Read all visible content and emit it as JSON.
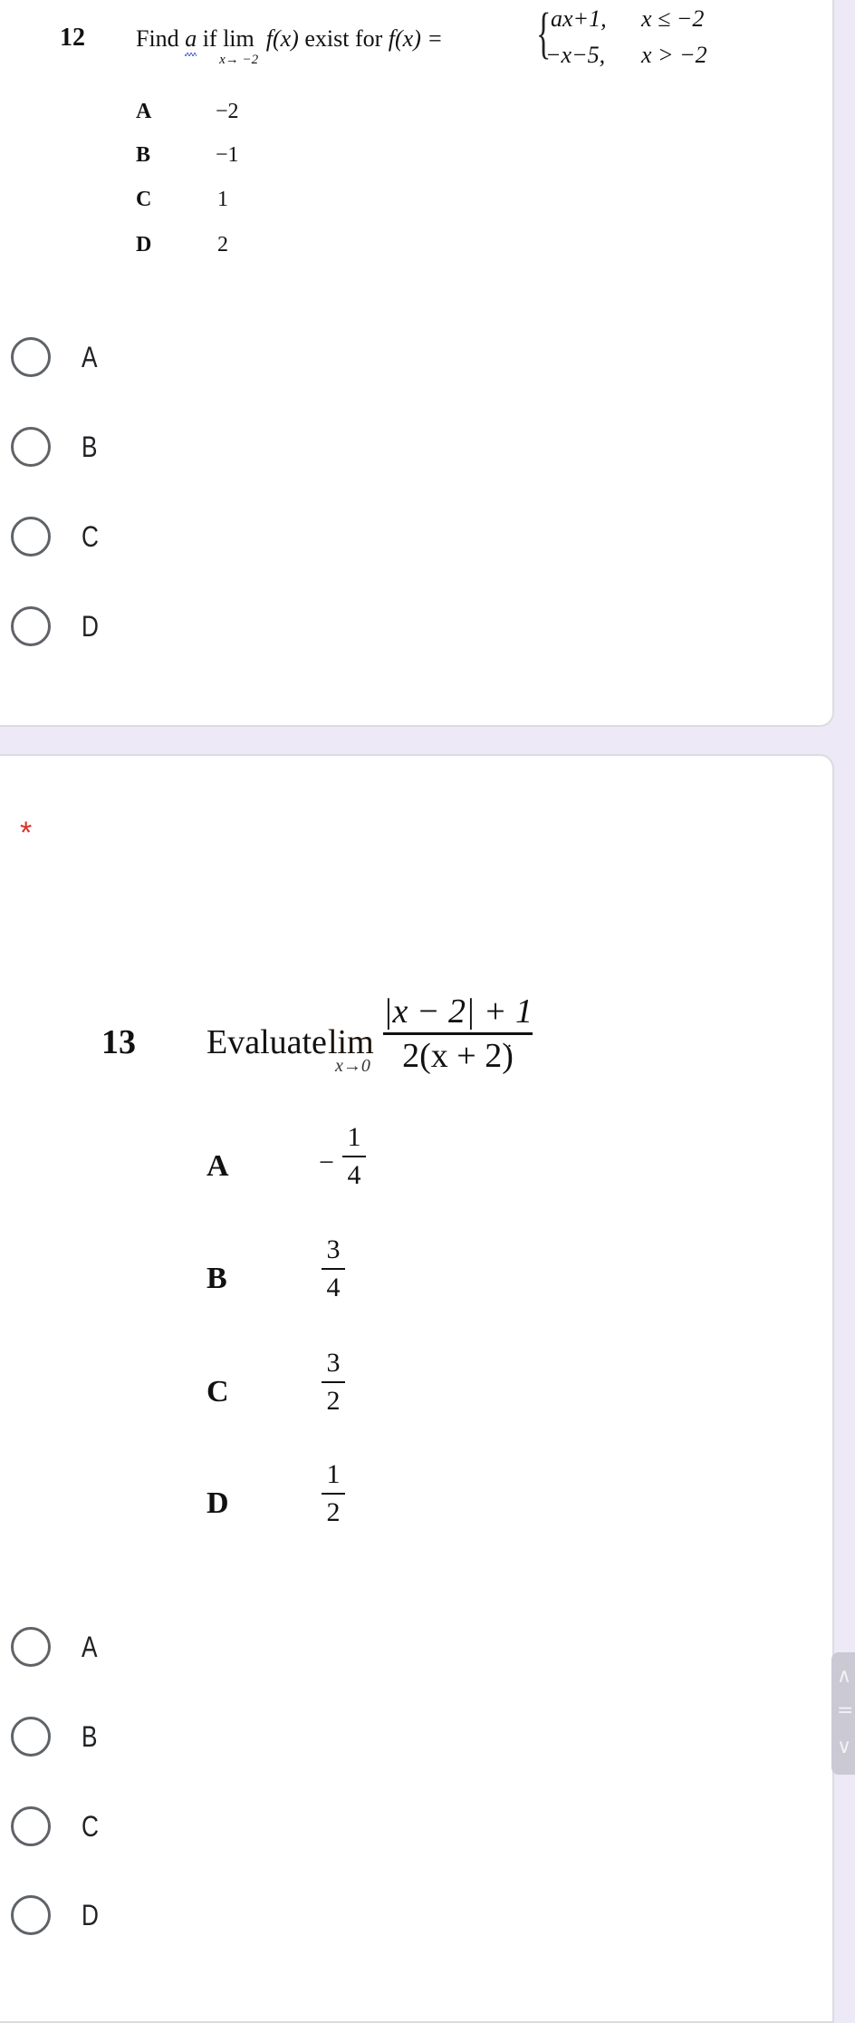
{
  "colors": {
    "background": "#ede9f7",
    "card": "#ffffff",
    "required": "#d93025",
    "radio_border": "#5f6368"
  },
  "question12": {
    "number": "12",
    "prompt_prefix": "Find",
    "variable": "a",
    "prompt_if": "if",
    "lim_word": "lim",
    "lim_sub": "x→ −2",
    "func_call": "f(x)",
    "prompt_mid": "exist for",
    "func_def": "f(x) =",
    "piecewise": [
      {
        "expr": "ax+1,",
        "cond": "x ≤ −2"
      },
      {
        "expr": "−x−5,",
        "cond": "x > −2"
      }
    ],
    "options": [
      {
        "letter": "A",
        "value": "−2"
      },
      {
        "letter": "B",
        "value": "−1"
      },
      {
        "letter": "C",
        "value": "1"
      },
      {
        "letter": "D",
        "value": "2"
      }
    ],
    "radio_choices": [
      "A",
      "B",
      "C",
      "D"
    ]
  },
  "question13": {
    "required_mark": "*",
    "number": "13",
    "prompt": "Evaluate",
    "lim_word": "lim",
    "lim_sub": "x→0",
    "numerator": "|x − 2| + 1",
    "denominator": "2(x + 2)",
    "end_punct": ".",
    "options": [
      {
        "letter": "A",
        "sign": "−",
        "num": "1",
        "den": "4"
      },
      {
        "letter": "B",
        "sign": "",
        "num": "3",
        "den": "4"
      },
      {
        "letter": "C",
        "sign": "",
        "num": "3",
        "den": "2"
      },
      {
        "letter": "D",
        "sign": "",
        "num": "1",
        "den": "2"
      }
    ],
    "radio_choices": [
      "A",
      "B",
      "C",
      "D"
    ]
  },
  "scroll_widget": {
    "up_icon": "∧",
    "handle_icon": "=",
    "down_icon": "∨"
  }
}
